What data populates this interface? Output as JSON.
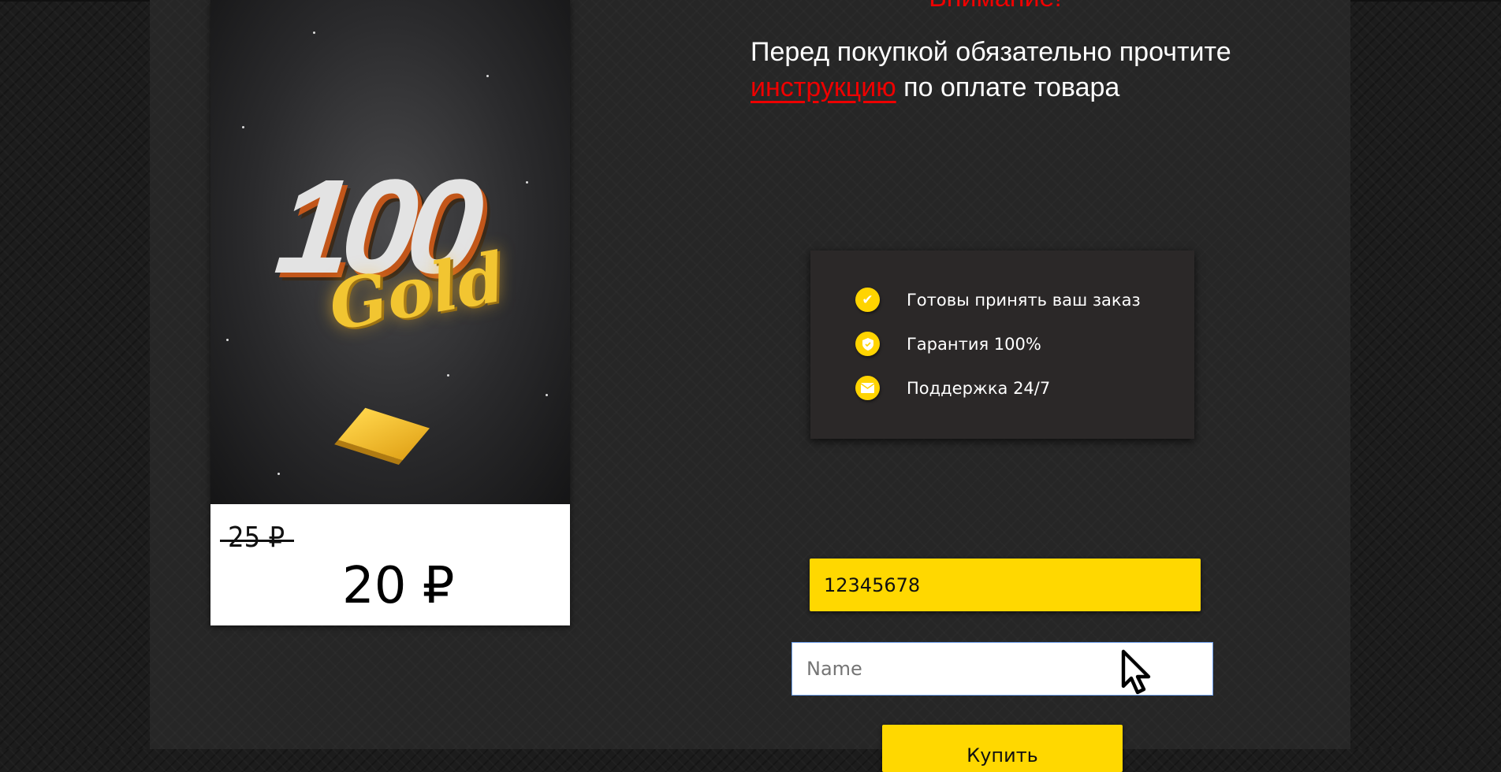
{
  "product": {
    "image_title": "100 Gold",
    "old_price": "25 ₽",
    "price": "20 ₽"
  },
  "notice": {
    "heading": "Внимание!",
    "text_before": "Перед покупкой обязательно прочтите",
    "link": "инструкцию",
    "text_after": "по оплате товара"
  },
  "features": [
    {
      "icon": "check-icon",
      "label": "Готовы принять ваш заказ"
    },
    {
      "icon": "shield-icon",
      "label": "Гарантия 100%"
    },
    {
      "icon": "envelope-icon",
      "label": "Поддержка 24/7"
    }
  ],
  "form": {
    "id_value": "12345678",
    "name_placeholder": "Name",
    "buy_label": "Купить"
  },
  "colors": {
    "accent": "#ffd800",
    "warning": "#ee0000"
  }
}
